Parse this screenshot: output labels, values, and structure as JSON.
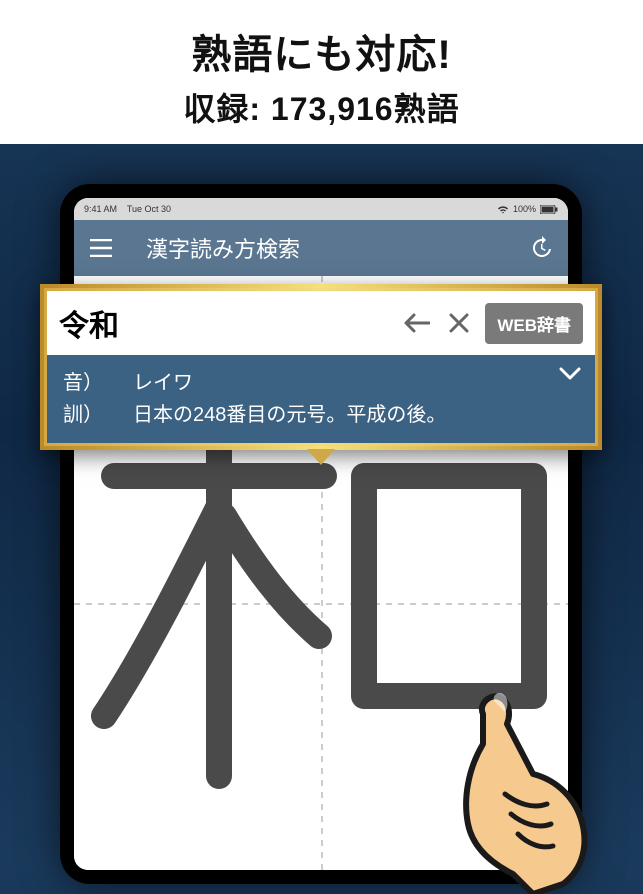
{
  "promo": {
    "title": "熟語にも対応!",
    "subtitle": "収録: 173,916熟語"
  },
  "statusbar": {
    "time": "9:41 AM",
    "date": "Tue Oct 30",
    "battery": "100%"
  },
  "app": {
    "title": "漢字読み方検索"
  },
  "search": {
    "query": "令和",
    "web_dict_label": "WEB辞書"
  },
  "result": {
    "on_label": "音）",
    "on_value": "レイワ",
    "kun_label": "訓）",
    "kun_value": "日本の248番目の元号。平成の後。"
  },
  "canvas": {
    "drawn_kanji": "和"
  },
  "icons": {
    "menu": "menu-icon",
    "history": "history-icon",
    "back": "arrow-left-icon",
    "clear": "close-icon",
    "expand": "chevron-down-icon"
  }
}
